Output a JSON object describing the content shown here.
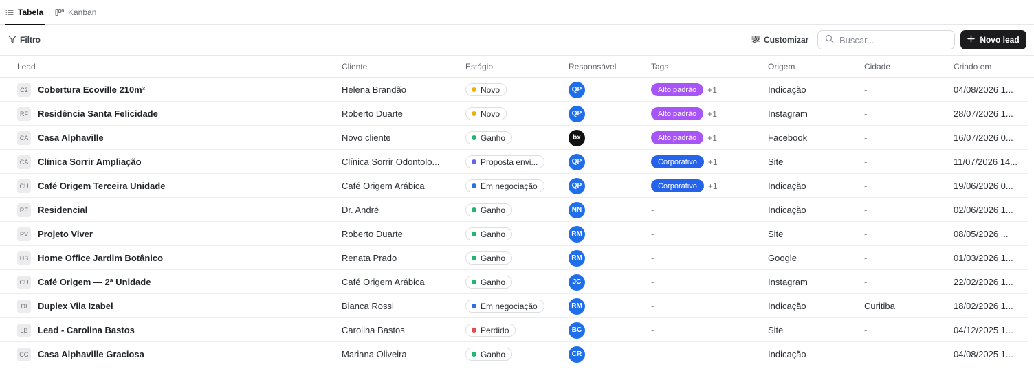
{
  "tabs": [
    {
      "label": "Tabela",
      "icon": "list-icon",
      "active": true
    },
    {
      "label": "Kanban",
      "icon": "kanban-icon",
      "active": false
    }
  ],
  "toolbar": {
    "filter_label": "Filtro",
    "customize_label": "Customizar",
    "search_placeholder": "Buscar...",
    "new_lead_label": "Novo lead"
  },
  "columns": {
    "lead": "Lead",
    "client": "Cliente",
    "stage": "Estágio",
    "owner": "Responsável",
    "tags": "Tags",
    "origin": "Origem",
    "city": "Cidade",
    "created": "Criado em"
  },
  "colors": {
    "novo": "#e9b308",
    "ganho": "#22b573",
    "proposta": "#6366f1",
    "negociacao": "#2f6fe4",
    "perdido": "#e5484d",
    "tag_alto_padrao": "#a855f7",
    "tag_corporativo": "#2563eb",
    "avatar_blue": "#1f6feb"
  },
  "rows": [
    {
      "initials": "C2",
      "name": "Cobertura Ecoville 210m²",
      "client": "Helena Brandão",
      "stage": "Novo",
      "stage_color": "#e9b308",
      "owner": "QP",
      "owner_style": "blue",
      "tag": "Alto padrão",
      "tag_color": "#a855f7",
      "tag_more": "+1",
      "origin": "Indicação",
      "city": "-",
      "created": "04/08/2026 1..."
    },
    {
      "initials": "RF",
      "name": "Residência Santa Felicidade",
      "client": "Roberto Duarte",
      "stage": "Novo",
      "stage_color": "#e9b308",
      "owner": "QP",
      "owner_style": "blue",
      "tag": "Alto padrão",
      "tag_color": "#a855f7",
      "tag_more": "+1",
      "origin": "Instagram",
      "city": "-",
      "created": "28/07/2026 1..."
    },
    {
      "initials": "CA",
      "name": "Casa Alphaville",
      "client": "Novo cliente",
      "stage": "Ganho",
      "stage_color": "#22b573",
      "owner": "bx",
      "owner_style": "black",
      "tag": "Alto padrão",
      "tag_color": "#a855f7",
      "tag_more": "+1",
      "origin": "Facebook",
      "city": "-",
      "created": "16/07/2026 0..."
    },
    {
      "initials": "CA",
      "name": "Clínica Sorrir Ampliação",
      "client": "Clínica Sorrir Odontolo...",
      "stage": "Proposta envi...",
      "stage_color": "#6366f1",
      "owner": "QP",
      "owner_style": "blue",
      "tag": "Corporativo",
      "tag_color": "#2563eb",
      "tag_more": "+1",
      "origin": "Site",
      "city": "-",
      "created": "11/07/2026 14..."
    },
    {
      "initials": "CU",
      "name": "Café Origem Terceira Unidade",
      "client": "Café Origem Arábica",
      "stage": "Em negociação",
      "stage_color": "#2f6fe4",
      "owner": "QP",
      "owner_style": "blue",
      "tag": "Corporativo",
      "tag_color": "#2563eb",
      "tag_more": "+1",
      "origin": "Indicação",
      "city": "-",
      "created": "19/06/2026 0..."
    },
    {
      "initials": "RE",
      "name": "Residencial",
      "client": "Dr. André",
      "stage": "Ganho",
      "stage_color": "#22b573",
      "owner": "NN",
      "owner_style": "blue",
      "tag": "",
      "tag_color": "",
      "tag_more": "",
      "tags_empty": "-",
      "origin": "Indicação",
      "city": "-",
      "created": "02/06/2026 1..."
    },
    {
      "initials": "PV",
      "name": "Projeto Viver",
      "client": "Roberto Duarte",
      "stage": "Ganho",
      "stage_color": "#22b573",
      "owner": "RM",
      "owner_style": "blue",
      "tag": "",
      "tag_color": "",
      "tag_more": "",
      "tags_empty": "-",
      "origin": "Site",
      "city": "-",
      "created": "08/05/2026 ..."
    },
    {
      "initials": "HB",
      "name": "Home Office Jardim Botânico",
      "client": "Renata Prado",
      "stage": "Ganho",
      "stage_color": "#22b573",
      "owner": "RM",
      "owner_style": "blue",
      "tag": "",
      "tag_color": "",
      "tag_more": "",
      "tags_empty": "-",
      "origin": "Google",
      "city": "-",
      "created": "01/03/2026 1..."
    },
    {
      "initials": "CU",
      "name": "Café Origem — 2ª Unidade",
      "client": "Café Origem Arábica",
      "stage": "Ganho",
      "stage_color": "#22b573",
      "owner": "JC",
      "owner_style": "blue",
      "tag": "",
      "tag_color": "",
      "tag_more": "",
      "tags_empty": "-",
      "origin": "Instagram",
      "city": "-",
      "created": "22/02/2026 1..."
    },
    {
      "initials": "DI",
      "name": "Duplex Vila Izabel",
      "client": "Bianca Rossi",
      "stage": "Em negociação",
      "stage_color": "#2f6fe4",
      "owner": "RM",
      "owner_style": "blue",
      "tag": "",
      "tag_color": "",
      "tag_more": "",
      "tags_empty": "-",
      "origin": "Indicação",
      "city": "Curitiba",
      "created": "18/02/2026 1..."
    },
    {
      "initials": "LB",
      "name": "Lead - Carolina Bastos",
      "client": "Carolina Bastos",
      "stage": "Perdido",
      "stage_color": "#e5484d",
      "owner": "BC",
      "owner_style": "blue",
      "tag": "",
      "tag_color": "",
      "tag_more": "",
      "tags_empty": "-",
      "origin": "Site",
      "city": "-",
      "created": "04/12/2025 1..."
    },
    {
      "initials": "CG",
      "name": "Casa Alphaville Graciosa",
      "client": "Mariana Oliveira",
      "stage": "Ganho",
      "stage_color": "#22b573",
      "owner": "CR",
      "owner_style": "blue",
      "tag": "",
      "tag_color": "",
      "tag_more": "",
      "tags_empty": "-",
      "origin": "Indicação",
      "city": "-",
      "created": "04/08/2025 1..."
    }
  ]
}
